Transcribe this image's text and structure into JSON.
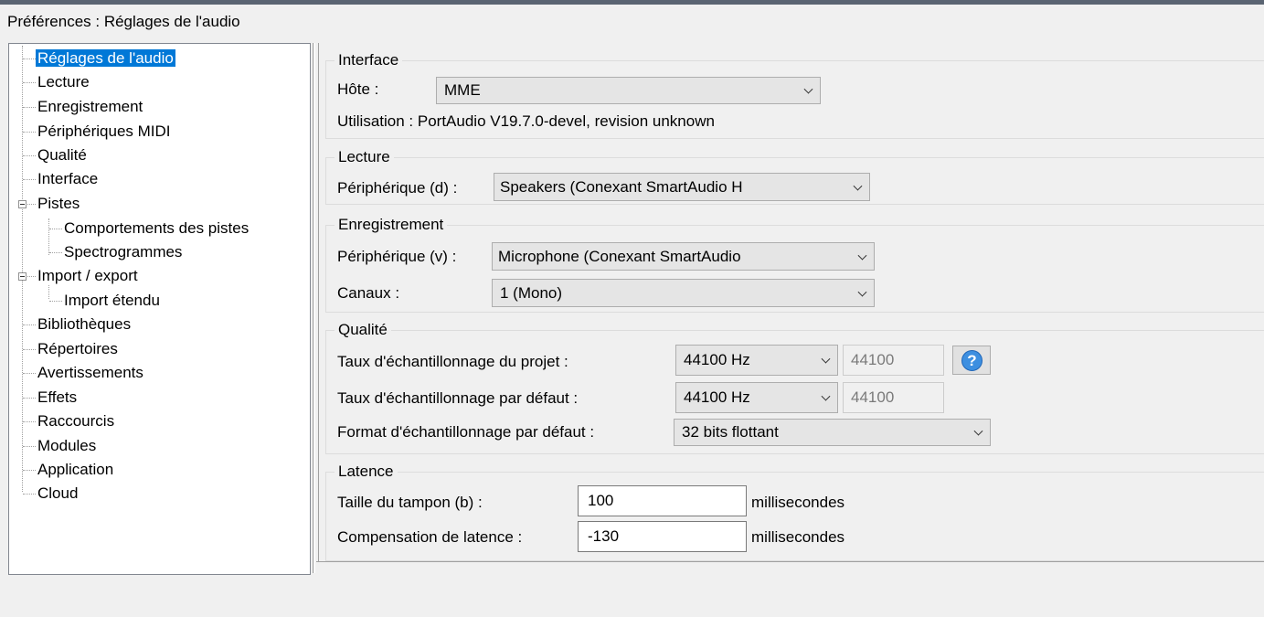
{
  "window": {
    "title": "Préférences : Réglages de l'audio"
  },
  "tree": {
    "items": [
      {
        "label": "Réglages de l'audio"
      },
      {
        "label": "Lecture"
      },
      {
        "label": "Enregistrement"
      },
      {
        "label": "Périphériques MIDI"
      },
      {
        "label": "Qualité"
      },
      {
        "label": "Interface"
      },
      {
        "label": "Pistes"
      },
      {
        "label": "Comportements des pistes"
      },
      {
        "label": "Spectrogrammes"
      },
      {
        "label": "Import / export"
      },
      {
        "label": "Import étendu"
      },
      {
        "label": "Bibliothèques"
      },
      {
        "label": "Répertoires"
      },
      {
        "label": "Avertissements"
      },
      {
        "label": "Effets"
      },
      {
        "label": "Raccourcis"
      },
      {
        "label": "Modules"
      },
      {
        "label": "Application"
      },
      {
        "label": "Cloud"
      }
    ]
  },
  "interface": {
    "title": "Interface",
    "host_label": "Hôte :",
    "host_value": "MME",
    "usage_text": "Utilisation : PortAudio V19.7.0-devel, revision unknown"
  },
  "playback": {
    "title": "Lecture",
    "device_label": "Périphérique (d) :",
    "device_value": "Speakers (Conexant SmartAudio H"
  },
  "recording": {
    "title": "Enregistrement",
    "device_label": "Périphérique (v) :",
    "device_value": "Microphone (Conexant SmartAudio",
    "channels_label": "Canaux :",
    "channels_value": "1 (Mono)"
  },
  "quality": {
    "title": "Qualité",
    "project_rate_label": "Taux d'échantillonnage du projet :",
    "project_rate_value": "44100 Hz",
    "project_rate_text": "44100",
    "default_rate_label": "Taux d'échantillonnage par défaut :",
    "default_rate_value": "44100 Hz",
    "default_rate_text": "44100",
    "format_label": "Format d'échantillonnage par défaut :",
    "format_value": "32 bits flottant",
    "help_glyph": "?"
  },
  "latency": {
    "title": "Latence",
    "buffer_label": "Taille du tampon (b) :",
    "buffer_value": "100",
    "buffer_unit": "millisecondes",
    "compensation_label": "Compensation de latence :",
    "compensation_value": "-130",
    "compensation_unit": "millisecondes"
  },
  "colors": {
    "selection": "#0078d7",
    "help_icon": "#3d8fe0"
  }
}
